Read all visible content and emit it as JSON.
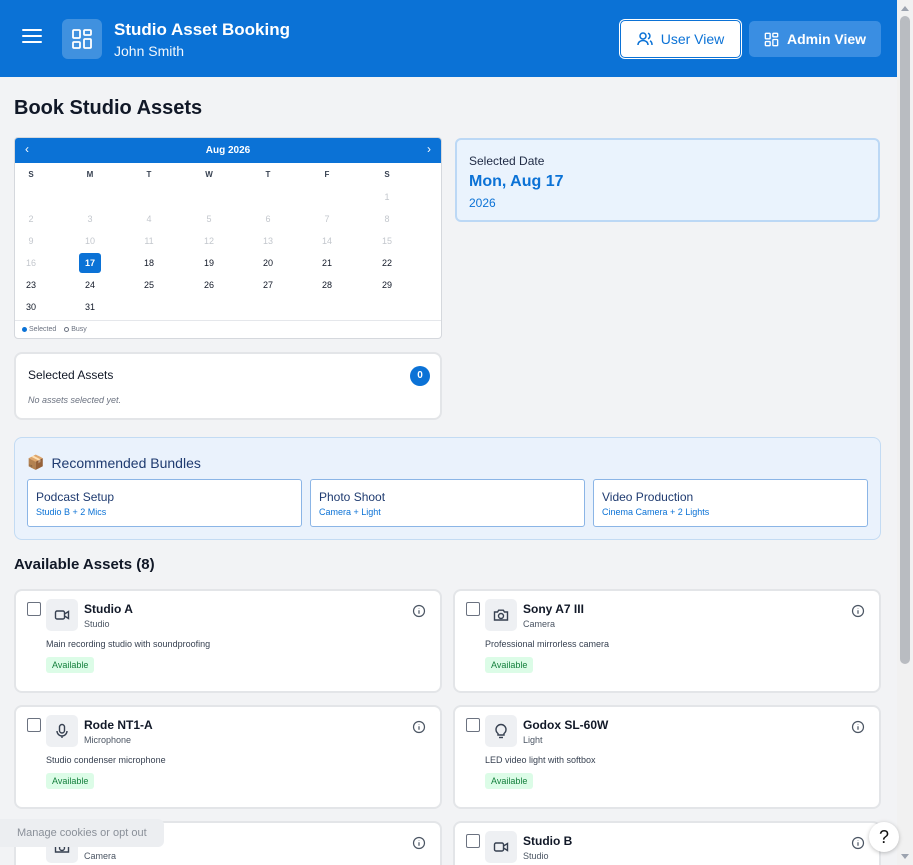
{
  "header": {
    "app_title": "Studio Asset Booking",
    "user_name": "John Smith",
    "user_view_label": "User View",
    "admin_view_label": "Admin View",
    "brand_color": "#0b72d6"
  },
  "page": {
    "title": "Book Studio Assets"
  },
  "calendar": {
    "month_label": "Aug 2026",
    "prev_label": "‹",
    "next_label": "›",
    "weekdays": [
      "S",
      "M",
      "T",
      "W",
      "T",
      "F",
      "S"
    ],
    "first_weekday_index": 6,
    "days_in_month": 31,
    "disabled_through": 16,
    "selected_day": 17,
    "legend_selected": "Selected",
    "legend_busy": "Busy"
  },
  "selected_date": {
    "label": "Selected Date",
    "date": "Mon, Aug 17",
    "year": "2026"
  },
  "selected_assets": {
    "title": "Selected Assets",
    "count": "0",
    "empty_text": "No assets selected yet."
  },
  "bundles": {
    "icon": "📦",
    "title": "Recommended Bundles",
    "items": [
      {
        "name": "Podcast Setup",
        "desc": "Studio B + 2 Mics"
      },
      {
        "name": "Photo Shoot",
        "desc": "Camera + Light"
      },
      {
        "name": "Video Production",
        "desc": "Cinema Camera + 2 Lights"
      }
    ]
  },
  "assets": {
    "title": "Available Assets (8)",
    "items": [
      {
        "name": "Studio A",
        "type": "Studio",
        "desc": "Main recording studio with soundproofing",
        "status": "Available",
        "icon": "video-icon"
      },
      {
        "name": "Sony A7 III",
        "type": "Camera",
        "desc": "Professional mirrorless camera",
        "status": "Available",
        "icon": "camera-icon"
      },
      {
        "name": "Rode NT1-A",
        "type": "Microphone",
        "desc": "Studio condenser microphone",
        "status": "Available",
        "icon": "microphone-icon"
      },
      {
        "name": "Godox SL-60W",
        "type": "Light",
        "desc": "LED video light with softbox",
        "status": "Available",
        "icon": "lightbulb-icon"
      },
      {
        "name": "",
        "type": "Camera",
        "desc": "",
        "status": "",
        "icon": "camera-icon"
      },
      {
        "name": "Studio B",
        "type": "Studio",
        "desc": "",
        "status": "",
        "icon": "video-icon"
      }
    ]
  },
  "cookie_text": "Manage cookies or opt out",
  "help_label": "?"
}
